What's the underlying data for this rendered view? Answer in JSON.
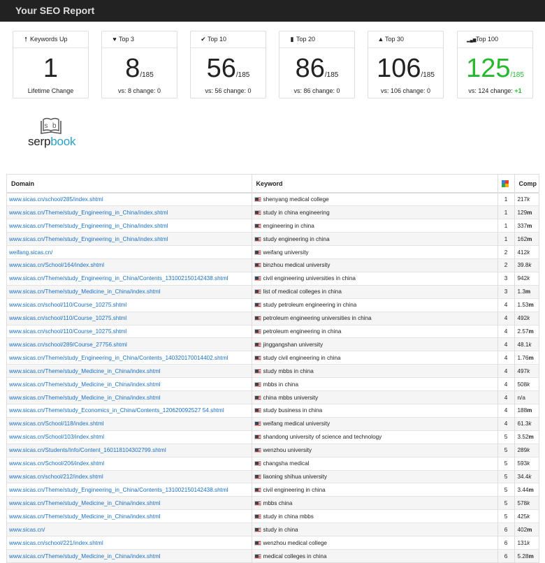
{
  "header": {
    "title": "Your SEO Report"
  },
  "cards": [
    {
      "icon": "arrow-up-icon",
      "glyph": "🠕",
      "label": "Keywords Up",
      "value": "1",
      "denominator": "",
      "sub": "Lifetime Change",
      "sub_plus": "",
      "green": false
    },
    {
      "icon": "heart-icon",
      "glyph": "♥",
      "label": "Top 3",
      "value": "8",
      "denominator": "/185",
      "sub": "vs: 8 change: 0",
      "sub_plus": "",
      "green": false
    },
    {
      "icon": "check-icon",
      "glyph": "✔",
      "label": "Top 10",
      "value": "56",
      "denominator": "/185",
      "sub": "vs: 56 change: 0",
      "sub_plus": "",
      "green": false
    },
    {
      "icon": "bookmark-icon",
      "glyph": "▮",
      "label": "Top 20",
      "value": "86",
      "denominator": "/185",
      "sub": "vs: 86 change: 0",
      "sub_plus": "",
      "green": false
    },
    {
      "icon": "road-icon",
      "glyph": "▲",
      "label": "Top 30",
      "value": "106",
      "denominator": "/185",
      "sub": "vs: 106 change: 0",
      "sub_plus": "",
      "green": false
    },
    {
      "icon": "signal-icon",
      "glyph": "▂▄▆",
      "label": "Top 100",
      "value": "125",
      "denominator": "/185",
      "sub": "vs: 124 change: ",
      "sub_plus": "+1",
      "green": true
    }
  ],
  "logo": {
    "text_a": "serp",
    "text_b": "book"
  },
  "table": {
    "headers": {
      "domain": "Domain",
      "keyword": "Keyword",
      "rank_icon": "google-icon",
      "comp": "Comp"
    },
    "rows": [
      {
        "domain": "www.sicas.cn/school/285/index.shtml",
        "keyword": "shenyang medical college",
        "rank": "1",
        "comp": "217",
        "unit": "k"
      },
      {
        "domain": "www.sicas.cn/Theme/study_Engineering_in_China/index.shtml",
        "keyword": "study in china engineering",
        "rank": "1",
        "comp": "129",
        "unit": "m"
      },
      {
        "domain": "www.sicas.cn/Theme/study_Engineering_in_China/index.shtml",
        "keyword": "engineering in china",
        "rank": "1",
        "comp": "337",
        "unit": "m"
      },
      {
        "domain": "www.sicas.cn/Theme/study_Engineering_in_China/index.shtml",
        "keyword": "study engineering in china",
        "rank": "1",
        "comp": "162",
        "unit": "m"
      },
      {
        "domain": "weifang.sicas.cn/",
        "keyword": "weifang university",
        "rank": "2",
        "comp": "412",
        "unit": "k"
      },
      {
        "domain": "www.sicas.cn/School/164/index.shtml",
        "keyword": "binzhou medical university",
        "rank": "2",
        "comp": "39.8",
        "unit": "k"
      },
      {
        "domain": "www.sicas.cn/Theme/study_Engineering_in_China/Contents_131002150142438.shtml",
        "keyword": "civil engineering universities in china",
        "rank": "3",
        "comp": "942",
        "unit": "k"
      },
      {
        "domain": "www.sicas.cn/Theme/study_Medicine_in_China/index.shtml",
        "keyword": "list of medical colleges in china",
        "rank": "3",
        "comp": "1.3",
        "unit": "m"
      },
      {
        "domain": "www.sicas.cn/school/110/Course_10275.shtml",
        "keyword": "study petroleum engineering in china",
        "rank": "4",
        "comp": "1.53",
        "unit": "m"
      },
      {
        "domain": "www.sicas.cn/school/110/Course_10275.shtml",
        "keyword": "petroleum engineering universities in china",
        "rank": "4",
        "comp": "492",
        "unit": "k"
      },
      {
        "domain": "www.sicas.cn/school/110/Course_10275.shtml",
        "keyword": "petroleum engineering in china",
        "rank": "4",
        "comp": "2.57",
        "unit": "m"
      },
      {
        "domain": "www.sicas.cn/school/289/Course_27756.shtml",
        "keyword": "jinggangshan university",
        "rank": "4",
        "comp": "48.1",
        "unit": "k"
      },
      {
        "domain": "www.sicas.cn/Theme/study_Engineering_in_China/Contents_140320170014402.shtml",
        "keyword": "study civil engineering in china",
        "rank": "4",
        "comp": "1.76",
        "unit": "m"
      },
      {
        "domain": "www.sicas.cn/Theme/study_Medicine_in_China/index.shtml",
        "keyword": "study mbbs in china",
        "rank": "4",
        "comp": "497",
        "unit": "k"
      },
      {
        "domain": "www.sicas.cn/Theme/study_Medicine_in_China/index.shtml",
        "keyword": "mbbs in china",
        "rank": "4",
        "comp": "508",
        "unit": "k"
      },
      {
        "domain": "www.sicas.cn/Theme/study_Medicine_in_China/index.shtml",
        "keyword": "china mbbs university",
        "rank": "4",
        "comp": "n/a",
        "unit": ""
      },
      {
        "domain": "www.sicas.cn/Theme/study_Economics_in_China/Contents_120620092527 54.shtml",
        "keyword": "study business in china",
        "rank": "4",
        "comp": "188",
        "unit": "m"
      },
      {
        "domain": "www.sicas.cn/School/118/index.shtml",
        "keyword": "weifang medical university",
        "rank": "4",
        "comp": "61.3",
        "unit": "k"
      },
      {
        "domain": "www.sicas.cn/School/103/index.shtml",
        "keyword": "shandong university of science and technology",
        "rank": "5",
        "comp": "3.52",
        "unit": "m"
      },
      {
        "domain": "www.sicas.cn/Students/Info/Content_160118104302799.shtml",
        "keyword": "wenzhou university",
        "rank": "5",
        "comp": "289",
        "unit": "k"
      },
      {
        "domain": "www.sicas.cn/School/206/index.shtml",
        "keyword": "changsha medical",
        "rank": "5",
        "comp": "593",
        "unit": "k"
      },
      {
        "domain": "www.sicas.cn/school/212/index.shtml",
        "keyword": "liaoning shihua university",
        "rank": "5",
        "comp": "34.4",
        "unit": "k"
      },
      {
        "domain": "www.sicas.cn/Theme/study_Engineering_in_China/Contents_131002150142438.shtml",
        "keyword": "civil engineering in china",
        "rank": "5",
        "comp": "3.44",
        "unit": "m"
      },
      {
        "domain": "www.sicas.cn/Theme/study_Medicine_in_China/index.shtml",
        "keyword": "mbbs china",
        "rank": "5",
        "comp": "578",
        "unit": "k"
      },
      {
        "domain": "www.sicas.cn/Theme/study_Medicine_in_China/index.shtml",
        "keyword": "study in china mbbs",
        "rank": "5",
        "comp": "425",
        "unit": "k"
      },
      {
        "domain": "www.sicas.cn/",
        "keyword": "study in china",
        "rank": "6",
        "comp": "402",
        "unit": "m"
      },
      {
        "domain": "www.sicas.cn/school/221/index.shtml",
        "keyword": "wenzhou medical college",
        "rank": "6",
        "comp": "131",
        "unit": "k"
      },
      {
        "domain": "www.sicas.cn/Theme/study_Medicine_in_China/index.shtml",
        "keyword": "medical colleges in china",
        "rank": "6",
        "comp": "5.28",
        "unit": "m"
      }
    ]
  }
}
